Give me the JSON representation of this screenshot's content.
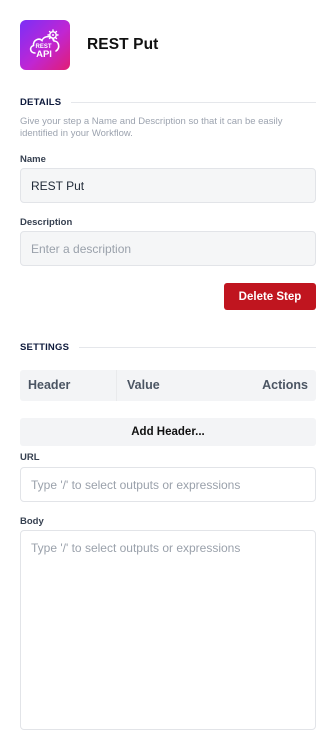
{
  "step": {
    "title": "REST Put",
    "icon": "rest-api-icon",
    "icon_text_top": "REST",
    "icon_text_bottom": "API"
  },
  "details": {
    "heading": "DETAILS",
    "help": "Give your step a Name and Description so that it can be easily identified in your Workflow.",
    "name_label": "Name",
    "name_value": "REST Put",
    "description_label": "Description",
    "description_placeholder": "Enter a description",
    "delete_label": "Delete Step"
  },
  "settings": {
    "heading": "SETTINGS",
    "table_columns": [
      "Header",
      "Value",
      "Actions"
    ],
    "add_header_label": "Add Header...",
    "url_label": "URL",
    "url_placeholder": "Type '/' to select outputs or expressions",
    "body_label": "Body",
    "body_placeholder": "Type '/' to select outputs or expressions"
  },
  "colors": {
    "accent_gradient_start": "#7b2ff7",
    "accent_gradient_end": "#e11d74",
    "danger": "#c0151f"
  }
}
